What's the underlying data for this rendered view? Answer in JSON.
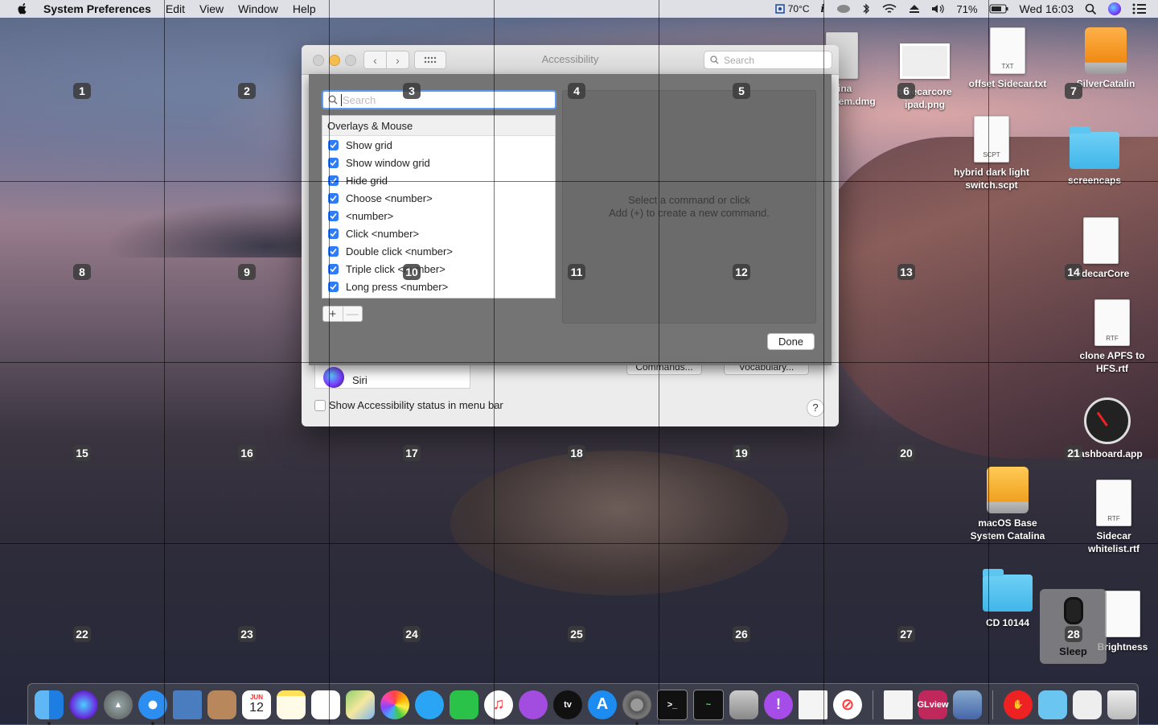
{
  "menubar": {
    "app_name": "System Preferences",
    "menus": [
      "Edit",
      "View",
      "Window",
      "Help"
    ],
    "temperature": "70°C",
    "battery": "71%",
    "clock": "Wed 16:03"
  },
  "grid": {
    "numbers": [
      "1",
      "2",
      "3",
      "4",
      "5",
      "6",
      "7",
      "8",
      "9",
      "10",
      "11",
      "12",
      "13",
      "14",
      "15",
      "16",
      "17",
      "18",
      "19",
      "20",
      "21",
      "22",
      "23",
      "24",
      "25",
      "26",
      "27",
      "28"
    ]
  },
  "window": {
    "title": "Accessibility",
    "search_placeholder": "Search",
    "behind": {
      "siri_label": "Siri",
      "commands_button": "Commands...",
      "vocabulary_button": "Vocabulary...",
      "status_checkbox_label": "Show Accessibility status in menu bar",
      "help_label": "?"
    }
  },
  "sheet": {
    "search_placeholder": "Search",
    "group_header": "Overlays & Mouse",
    "commands": [
      {
        "label": "Show grid",
        "checked": true
      },
      {
        "label": "Show window grid",
        "checked": true
      },
      {
        "label": "Hide grid",
        "checked": true
      },
      {
        "label": "Choose <number>",
        "checked": true
      },
      {
        "label": "<number>",
        "checked": true
      },
      {
        "label": "Click <number>",
        "checked": true
      },
      {
        "label": "Double click <number>",
        "checked": true
      },
      {
        "label": "Triple click <number>",
        "checked": true
      },
      {
        "label": "Long press <number>",
        "checked": true
      }
    ],
    "add_label": "+",
    "remove_label": "—",
    "detail_line1": "Select a command or click",
    "detail_line2": "Add (+) to create a new command.",
    "done_label": "Done"
  },
  "desktop": {
    "icons": [
      {
        "label": "alina stem.dmg",
        "kind": "dmg"
      },
      {
        "label": "sidecarcore ipad.png",
        "kind": "png"
      },
      {
        "label": "offset Sidecar.txt",
        "kind": "txt",
        "tag": "TXT"
      },
      {
        "label": "SilverCatalin",
        "kind": "drive"
      },
      {
        "label": "hybrid dark light switch.scpt",
        "kind": "scpt",
        "tag": "SCPT"
      },
      {
        "label": "screencaps",
        "kind": "folder"
      },
      {
        "label": "SidecarCore",
        "kind": "exec"
      },
      {
        "label": "clone APFS to HFS.rtf",
        "kind": "rtf",
        "tag": "RTF"
      },
      {
        "label": "Dashboard.app",
        "kind": "app"
      },
      {
        "label": "macOS Base System Catalina",
        "kind": "drive"
      },
      {
        "label": "Sidecar whitelist.rtf",
        "kind": "rtf",
        "tag": "RTF"
      },
      {
        "label": "CD 10144",
        "kind": "folder"
      },
      {
        "label": "Brightness",
        "kind": "exec"
      }
    ],
    "sleep_label": "Sleep"
  },
  "dock": {
    "calendar_month": "JUN",
    "calendar_day": "12",
    "tv_label": "tv",
    "glview_label": "GLview"
  },
  "colors": {
    "accent": "#2f7cf6",
    "grid_label_bg": "#3c3c3c",
    "sheet_bg": "#707070"
  }
}
